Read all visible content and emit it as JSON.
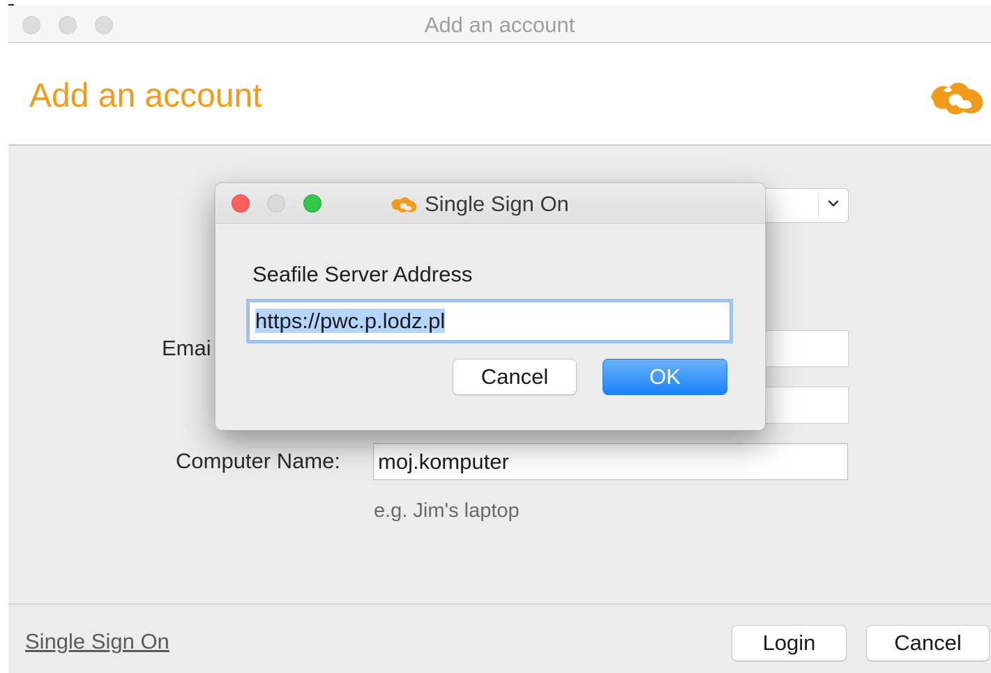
{
  "window": {
    "title": "Add an account"
  },
  "header": {
    "title": "Add an account",
    "logo_icon": "seafile-logo-icon",
    "accent_color": "#f19b1a"
  },
  "form": {
    "email_label_partial": "Emai",
    "computer_name_label": "Computer Name:",
    "computer_name_value": "moj.komputer",
    "computer_name_hint": "e.g. Jim's laptop"
  },
  "footer": {
    "sso_link": "Single Sign On",
    "login_label": "Login",
    "cancel_label": "Cancel"
  },
  "dialog": {
    "title": "Single Sign On",
    "title_icon": "seafile-logo-icon",
    "field_label": "Seafile Server Address",
    "field_value": "https://pwc.p.lodz.pl",
    "cancel_label": "Cancel",
    "ok_label": "OK",
    "ok_color": "#1a82fb"
  }
}
